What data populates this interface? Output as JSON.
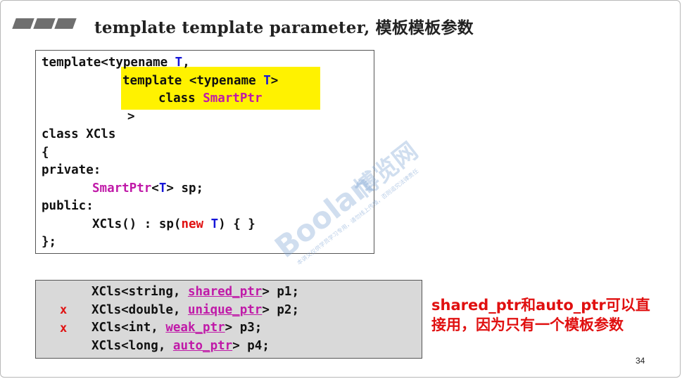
{
  "title": "template template parameter, 模板模板参数",
  "code": {
    "line1_a": "template<typename ",
    "line1_T": "T",
    "line1_b": ",",
    "line2_a": "template <typename ",
    "line2_T": "T",
    "line2_b": ">",
    "line3_a": "class ",
    "line3_b": "SmartPtr",
    "line4": ">",
    "line5": "class XCls",
    "line6": "{",
    "line7": "private:",
    "line8_a": "SmartPtr",
    "line8_b": "<",
    "line8_T": "T",
    "line8_c": "> sp;",
    "line9": "public:",
    "line10_a": "XCls() : sp(",
    "line10_new": "new",
    "line10_sp": " ",
    "line10_T": "T",
    "line10_b": ") { }",
    "line11": "};"
  },
  "usage": {
    "rows": [
      {
        "mark": "",
        "pre": "XCls<string, ",
        "ptr": "shared_ptr",
        "post": "> p1;"
      },
      {
        "mark": "x",
        "pre": "XCls<double, ",
        "ptr": "unique_ptr",
        "post": "> p2;"
      },
      {
        "mark": "x",
        "pre": "XCls<int, ",
        "ptr": "weak_ptr",
        "post": "> p3;"
      },
      {
        "mark": "",
        "pre": "XCls<long, ",
        "ptr": "auto_ptr",
        "post": "> p4;"
      }
    ]
  },
  "note": {
    "line1": "shared_ptr和auto_ptr可以直",
    "line2": "接用，因为只有一个模板参数"
  },
  "page_number": "34",
  "watermark": {
    "brand": "Boolan",
    "cn": "博览网",
    "sub": "本讲义仅供学员学习专用，请勿线上传播，否则追究法律责任"
  },
  "colors": {
    "accent_red": "#e01010",
    "type_blue": "#1515d8",
    "template_magenta": "#c01aa8",
    "highlight_yellow": "#fff200"
  }
}
